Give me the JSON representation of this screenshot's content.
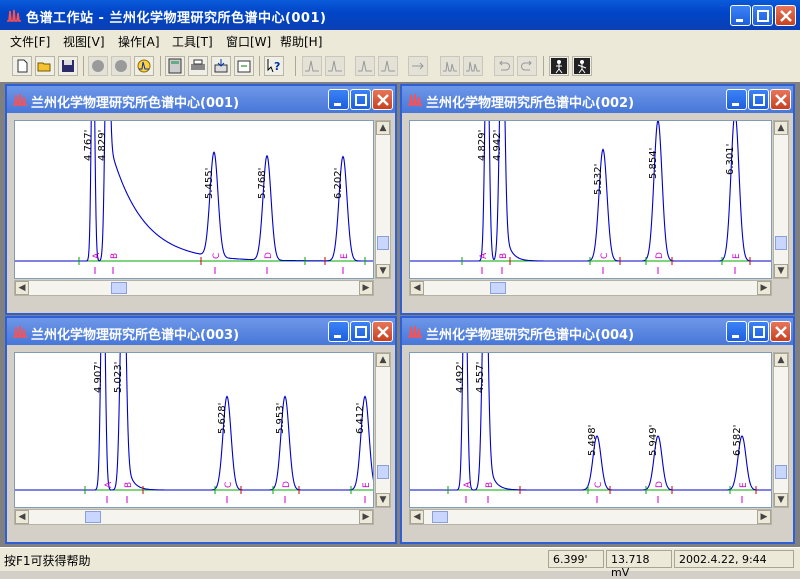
{
  "app": {
    "title": "色谱工作站 - 兰州化学物理研究所色谱中心(001)"
  },
  "menu": [
    "文件[F]",
    "视图[V]",
    "操作[A]",
    "工具[T]",
    "窗口[W]",
    "帮助[H]"
  ],
  "colors": {
    "trace": "#0000cc",
    "baseline": "#00aa00",
    "marker": "#cc00cc",
    "split": "#cc0000",
    "titlebar": "#0b4fd0"
  },
  "windows": [
    {
      "title": "兰州化学物理研究所色谱中心(001)",
      "peaks": [
        {
          "rt": "4.767'",
          "label": "A"
        },
        {
          "rt": "4.829'",
          "label": "B"
        },
        {
          "rt": "5.455'",
          "label": "C"
        },
        {
          "rt": "5.768'",
          "label": "D"
        },
        {
          "rt": "6.202'",
          "label": "E"
        }
      ]
    },
    {
      "title": "兰州化学物理研究所色谱中心(002)",
      "peaks": [
        {
          "rt": "4.829'",
          "label": "A"
        },
        {
          "rt": "4.942'",
          "label": "B"
        },
        {
          "rt": "5.532'",
          "label": "C"
        },
        {
          "rt": "5.854'",
          "label": "D"
        },
        {
          "rt": "6.301'",
          "label": "E"
        }
      ]
    },
    {
      "title": "兰州化学物理研究所色谱中心(003)",
      "peaks": [
        {
          "rt": "4.907'",
          "label": "A"
        },
        {
          "rt": "5.023'",
          "label": "B"
        },
        {
          "rt": "5.628'",
          "label": "C"
        },
        {
          "rt": "5.953'",
          "label": "D"
        },
        {
          "rt": "6.412'",
          "label": "E"
        }
      ]
    },
    {
      "title": "兰州化学物理研究所色谱中心(004)",
      "peaks": [
        {
          "rt": "4.492'",
          "label": "A"
        },
        {
          "rt": "4.557'",
          "label": "B"
        },
        {
          "rt": "5.498'",
          "label": "C"
        },
        {
          "rt": "5.949'",
          "label": "D"
        },
        {
          "rt": "6.582'",
          "label": "E"
        }
      ]
    }
  ],
  "status": {
    "help": "按F1可获得帮助",
    "time": "6.399'",
    "signal": "13.718 mV",
    "datetime": "2002.4.22, 9:44"
  }
}
